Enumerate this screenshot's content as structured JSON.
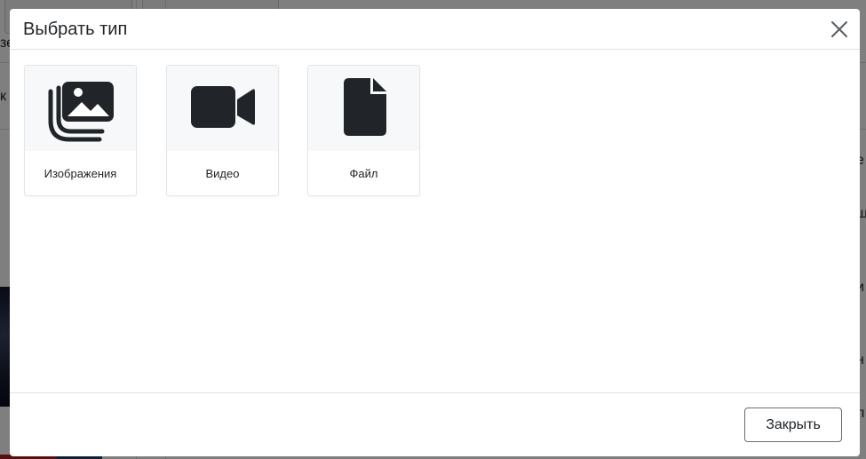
{
  "background": {
    "fragments": [
      "зе",
      "к",
      "е",
      "ш",
      "и",
      "н",
      "л"
    ]
  },
  "modal": {
    "title": "Выбрать тип",
    "close_icon": "close-icon",
    "types": [
      {
        "label": "Изображения",
        "icon": "images-icon"
      },
      {
        "label": "Видео",
        "icon": "video-camera-icon"
      },
      {
        "label": "Файл",
        "icon": "file-icon"
      }
    ],
    "footer": {
      "close_label": "Закрыть"
    }
  },
  "colors": {
    "icon": "#212529",
    "card_icon_bg": "#f7f8fa",
    "backdrop": "rgba(0,0,0,0.5)"
  }
}
